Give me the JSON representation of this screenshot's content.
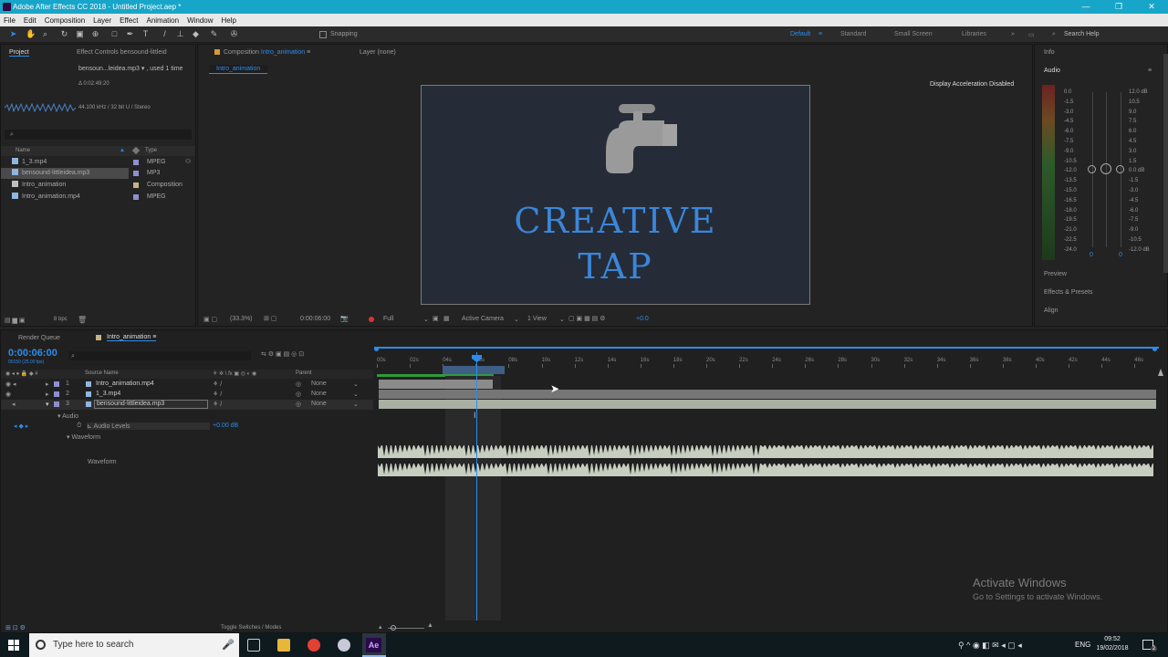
{
  "app": {
    "title": "Adobe After Effects CC 2018 - Untitled Project.aep *"
  },
  "menu": [
    "File",
    "Edit",
    "Composition",
    "Layer",
    "Effect",
    "Animation",
    "Window",
    "Help"
  ],
  "window_controls": [
    "—",
    "❐",
    "✕"
  ],
  "toolbar": {
    "snapping": "Snapping",
    "workspaces": [
      "Default",
      "Standard",
      "Small Screen",
      "Libraries"
    ],
    "overflow": "»",
    "search": "Search Help"
  },
  "project": {
    "tab": "Project",
    "effects_tab": "Effect Controls bensound-littleid",
    "preview_name": "bensoun...leidea.mp3 ▾ , used 1 time",
    "duration": "Δ 0:02:49:20",
    "audio_info": "44.100 kHz / 32 bit U / Stereo",
    "search_icon": "⌕",
    "columns": {
      "name": "Name",
      "type": "Type"
    },
    "items": [
      {
        "name": "1_3.mp4",
        "type": "MPEG",
        "color": "#8f8fd0"
      },
      {
        "name": "bensound-littleidea.mp3",
        "type": "MP3",
        "color": "#8f8fd0"
      },
      {
        "name": "Intro_animation",
        "type": "Composition",
        "color": "#c7b28a"
      },
      {
        "name": "Intro_animation.mp4",
        "type": "MPEG",
        "color": "#8f8fd0"
      }
    ],
    "bpc": "8 bpc"
  },
  "composition": {
    "tab": "Composition",
    "tab_name": "Intro_animation",
    "layer_tab": "Layer (none)",
    "subtab": "Intro_animation",
    "accel_note": "Display Acceleration Disabled",
    "canvas_title_line1": "CREATIVE",
    "canvas_title_line2": "TAP",
    "zoom": "(33.3%)",
    "timecode": "0:00:06:00",
    "resolution": "Full",
    "camera": "Active Camera",
    "views": "1 View",
    "offset": "+0.0",
    "bg_color": "#252c38",
    "title_color": "#3b86d9"
  },
  "info_panel": {
    "info": "Info",
    "audio": "Audio",
    "db_left": [
      "0.0",
      "-1.5",
      "-3.0",
      "-4.5",
      "-6.0",
      "-7.5",
      "-9.0",
      "-10.5",
      "-12.0",
      "-13.5",
      "-15.0",
      "-16.5",
      "-18.0",
      "-19.5",
      "-21.0",
      "-22.5",
      "-24.0"
    ],
    "db_right": [
      "12.0 dB",
      "10.5",
      "9.0",
      "7.5",
      "6.0",
      "4.5",
      "3.0",
      "1.5",
      "0.0 dB",
      "-1.5",
      "-3.0",
      "-4.5",
      "-6.0",
      "-7.5",
      "-9.0",
      "-10.5",
      "-12.0 dB"
    ],
    "zero_left": "0",
    "zero_right": "0",
    "sections": [
      "Preview",
      "Effects & Presets",
      "Align"
    ]
  },
  "timeline": {
    "render_queue": "Render Queue",
    "tab": "Intro_animation",
    "timecode": "0:00:06:00",
    "fps": "00150 (25.00 fps)",
    "col_source": "Source Name",
    "col_parent": "Parent",
    "layers": [
      {
        "num": "1",
        "name": "Intro_animation.mp4",
        "parent": "None"
      },
      {
        "num": "2",
        "name": "1_3.mp4",
        "parent": "None"
      },
      {
        "num": "3",
        "name": "bensound-littleidea.mp3",
        "parent": "None"
      }
    ],
    "audio": "Audio",
    "audio_levels": "Audio Levels",
    "audio_levels_value": "+0.00 dB",
    "waveform": "Waveform",
    "waveform2": "Waveform",
    "ticks": [
      "00s",
      "02s",
      "04s",
      "06s",
      "08s",
      "10s",
      "12s",
      "14s",
      "16s",
      "18s",
      "20s",
      "22s",
      "24s",
      "26s",
      "28s",
      "30s",
      "32s",
      "34s",
      "36s",
      "38s",
      "40s",
      "42s",
      "44s",
      "46s"
    ],
    "toggle": "Toggle Switches / Modes"
  },
  "watermark": {
    "line1": "Activate Windows",
    "line2": "Go to Settings to activate Windows."
  },
  "taskbar": {
    "search": "Type here to search",
    "lang": "ENG",
    "time": "09:52",
    "date": "19/02/2018",
    "ae": "Ae",
    "notif": "2"
  }
}
